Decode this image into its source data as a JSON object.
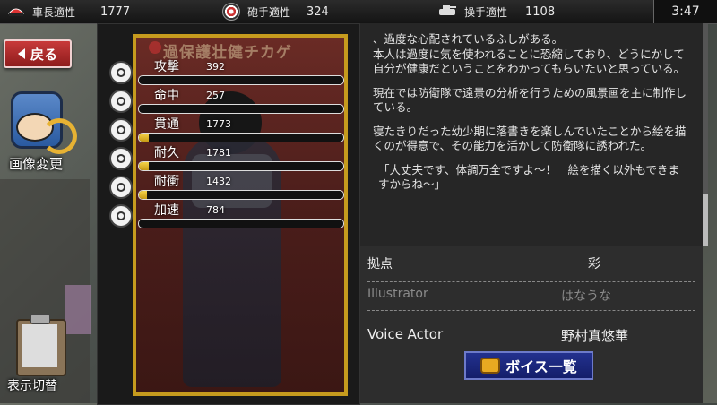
{
  "topbar": {
    "commander": {
      "label": "車長適性",
      "value": "1777"
    },
    "gunner": {
      "label": "砲手適性",
      "value": "324"
    },
    "driver": {
      "label": "操手適性",
      "value": "1108"
    },
    "clock": "3:47"
  },
  "nav": {
    "back_label": "戻る"
  },
  "side": {
    "change_image_label": "画像変更",
    "toggle_label": "表示切替"
  },
  "card": {
    "name": "過保護壮健チカゲ"
  },
  "stats": [
    {
      "label": "攻撃",
      "value": "392",
      "fill": 0.0
    },
    {
      "label": "命中",
      "value": "257",
      "fill": 0.0
    },
    {
      "label": "貫通",
      "value": "1773",
      "fill": 0.05
    },
    {
      "label": "耐久",
      "value": "1781",
      "fill": 0.05
    },
    {
      "label": "耐衝",
      "value": "1432",
      "fill": 0.04
    },
    {
      "label": "加速",
      "value": "784",
      "fill": 0.0
    }
  ],
  "description": {
    "p1_line0": "、過度な心配されているふしがある。",
    "p1": "本人は過度に気を使われることに恐縮しており、どうにかして自分が健康だということをわかってもらいたいと思っている。",
    "p2": "現在では防衛隊で遠景の分析を行うための風景画を主に制作している。",
    "p3": "寝たきりだった幼少期に落書きを楽しんでいたことから絵を描くのが得意で、その能力を活かして防衛隊に誘われた。",
    "quote": "「大丈夫です、体調万全ですよ～！　絵を描く以外もできますからね～」"
  },
  "info": {
    "base_label": "拠点",
    "base_value": "彩",
    "illustrator_label": "Illustrator",
    "illustrator_value": "はなうな",
    "voice_label": "Voice Actor",
    "voice_value": "野村真悠華",
    "voice_button": "ボイス一覧"
  }
}
